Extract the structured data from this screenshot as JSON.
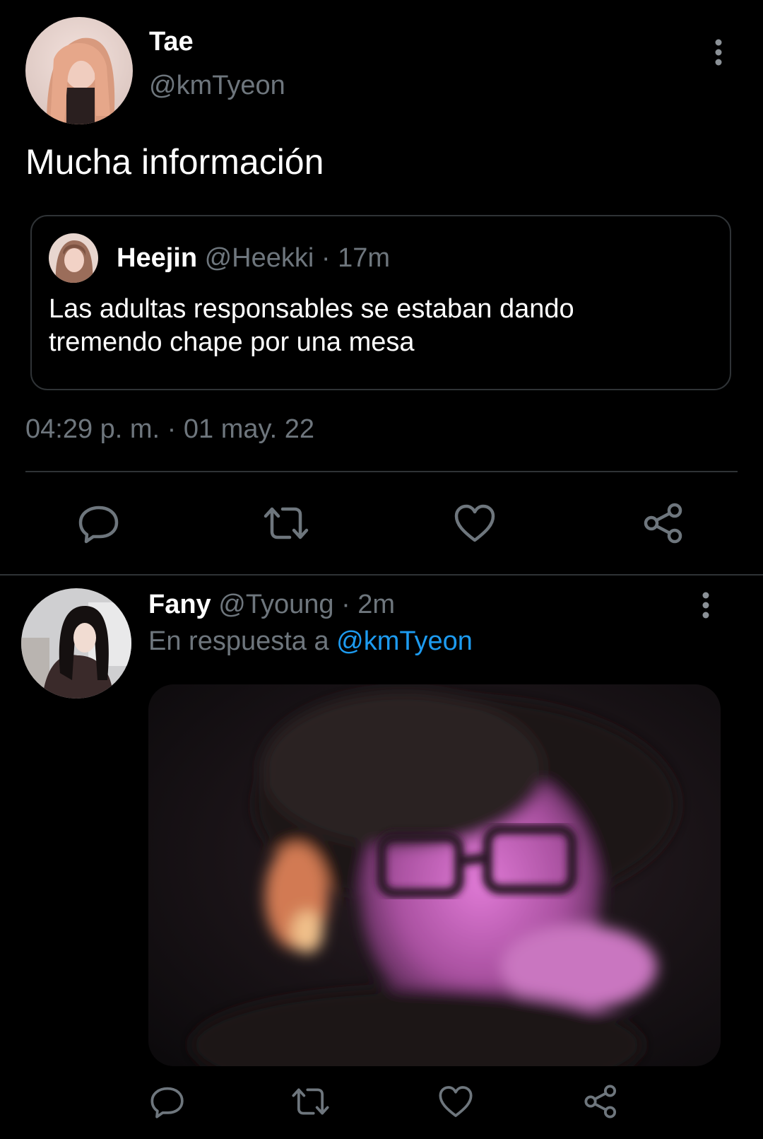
{
  "main_tweet": {
    "author_name": "Tae",
    "author_handle": "@kmTyeon",
    "text": "Mucha información",
    "quoted": {
      "author_name": "Heejin",
      "author_handle": "@Heekki",
      "separator": "·",
      "age": "17m",
      "text": "Las adultas responsables se estaban dando tremendo chape por una mesa"
    },
    "timestamp": "04:29 p. m. · 01 may. 22",
    "actions": [
      "reply-icon",
      "retweet-icon",
      "like-icon",
      "share-icon"
    ]
  },
  "reply": {
    "author_name": "Fany",
    "author_handle": "@Tyoung",
    "separator": "·",
    "age": "2m",
    "reply_prefix": "En respuesta a",
    "reply_to": "@kmTyeon",
    "actions": [
      "reply-icon",
      "retweet-icon",
      "like-icon",
      "share-icon"
    ]
  },
  "colors": {
    "background": "#000000",
    "muted_text": "#6e767d",
    "link": "#1d9bf0",
    "divider": "#2f3336"
  }
}
